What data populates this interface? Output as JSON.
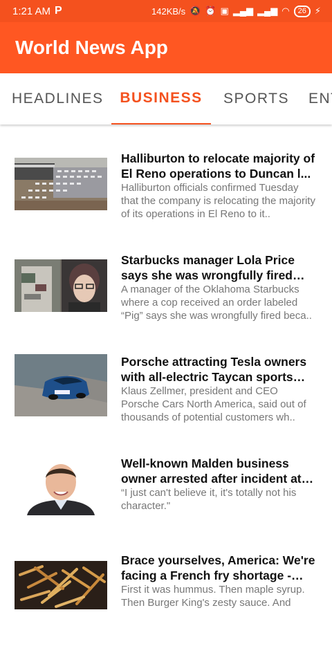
{
  "status_bar": {
    "time": "1:21 AM",
    "app_badge": "P",
    "net_speed": "142KB/s",
    "battery": "26"
  },
  "app_bar": {
    "title": "World News App"
  },
  "tabs": [
    {
      "label": "HEADLINES",
      "selected": false
    },
    {
      "label": "BUSINESS",
      "selected": true
    },
    {
      "label": "SPORTS",
      "selected": false
    },
    {
      "label": "ENT",
      "selected": false
    }
  ],
  "accent_color": "#f4511e",
  "articles": [
    {
      "title": "Halliburton to relocate majority of El Reno operations to Duncan l...",
      "description": "Halliburton officials confirmed Tuesday that the company is relocating the majority of its operations in El Reno to it..",
      "image": "aerial-parking-lot"
    },
    {
      "title": "Starbucks manager Lola Price says she was wrongfully fired over 'pig'..",
      "description": "A manager of the Oklahoma Starbucks where a cop received an order labeled “Pig” says she was wrongfully fired beca..",
      "image": "cup-and-woman-portrait"
    },
    {
      "title": "Porsche attracting Tesla owners with all-electric Taycan sports car..",
      "description": "Klaus Zellmer, president and CEO Porsche Cars North America, said out of thousands of potential customers wh..",
      "image": "blue-sports-car"
    },
    {
      "title": "Well-known Malden business owner arrested after incident at L...",
      "description": "“I just can't believe it, it's totally not his character.\"",
      "image": "man-portrait"
    },
    {
      "title": "Brace yourselves, America: We're facing a French fry shortage - The..",
      "description": "First it was hummus. Then maple syrup. Then Burger King's zesty sauce. And",
      "image": "french-fries"
    }
  ]
}
